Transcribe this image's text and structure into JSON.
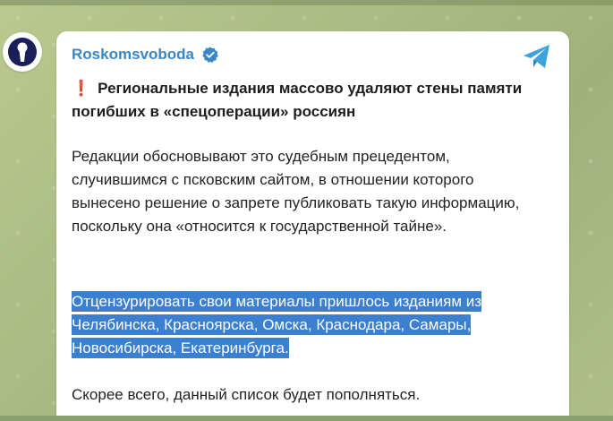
{
  "channel": {
    "name": "Roskomsvoboda",
    "verified_icon": "verified-badge-icon",
    "logo_icon": "keyhole-icon",
    "share_icon": "telegram-paper-plane-icon"
  },
  "post": {
    "headline_mark": "❗",
    "headline": "Региональные издания массово удаляют стены памяти погибших в «спецоперации» россиян",
    "paragraph1": "Редакции обосновывают это судебным прецедентом, случившимся с псковским сайтом, в отношении которого вынесено решение о запрете публиковать такую информацию, поскольку она «относится к государственной тайне».",
    "paragraph2": "Отцензурировать свои материалы пришлось изданиям из Челябинска, Красноярска, Омска, Краснодара, Самары, Новосибирска, Екатеринбурга.",
    "paragraph3": "Скорее всего, данный список будет пополняться."
  },
  "colors": {
    "accent": "#3b86c4",
    "selection": "#3b7fd0",
    "headline_mark": "#e2262a"
  }
}
